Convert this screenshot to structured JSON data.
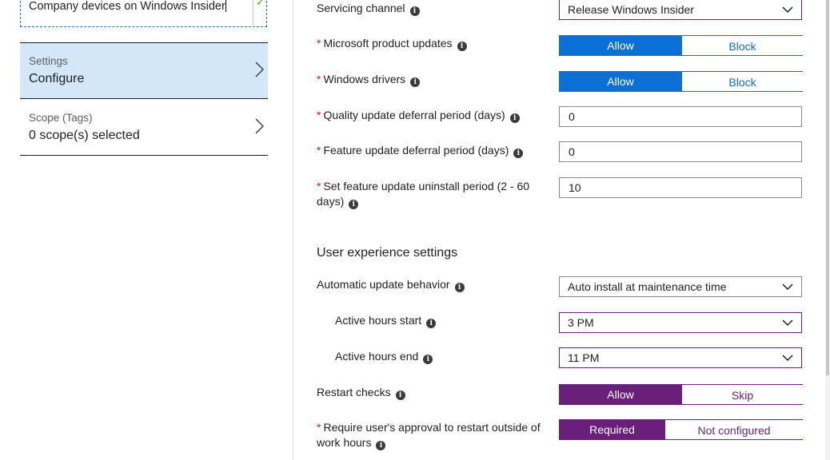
{
  "blade": {
    "name_value": "Company devices on Windows Insider",
    "items": [
      {
        "label": "Settings",
        "value": "Configure"
      },
      {
        "label": "Scope (Tags)",
        "value": "0 scope(s) selected"
      }
    ]
  },
  "form": {
    "servicing_channel": {
      "label": "Servicing channel",
      "value": "Release Windows Insider"
    },
    "ms_product_updates": {
      "label": "Microsoft product updates",
      "on": "Allow",
      "off": "Block"
    },
    "windows_drivers": {
      "label": "Windows drivers",
      "on": "Allow",
      "off": "Block"
    },
    "quality_deferral": {
      "label": "Quality update deferral period (days)",
      "value": "0"
    },
    "feature_deferral": {
      "label": "Feature update deferral period (days)",
      "value": "0"
    },
    "uninstall_period": {
      "label": "Set feature update uninstall period (2 - 60 days)",
      "value": "10"
    },
    "ux_section_title": "User experience settings",
    "auto_update_behavior": {
      "label": "Automatic update behavior",
      "value": "Auto install at maintenance time"
    },
    "active_hours_start": {
      "label": "Active hours start",
      "value": "3 PM"
    },
    "active_hours_end": {
      "label": "Active hours end",
      "value": "11 PM"
    },
    "restart_checks": {
      "label": "Restart checks",
      "on": "Allow",
      "off": "Skip"
    },
    "require_approval": {
      "label": "Require user's approval to restart outside of work hours",
      "on": "Required",
      "off": "Not configured"
    }
  },
  "icons": {
    "info": "info-icon",
    "chevron_right": "chevron-right-icon",
    "dropdown": "chevron-down-icon",
    "check": "checkmark-icon"
  },
  "colors": {
    "allow_blue": "#0b6fd6",
    "accent_purple": "#6a1f7a",
    "selected_bg": "#d3e7f9",
    "required_red": "#e81123"
  }
}
